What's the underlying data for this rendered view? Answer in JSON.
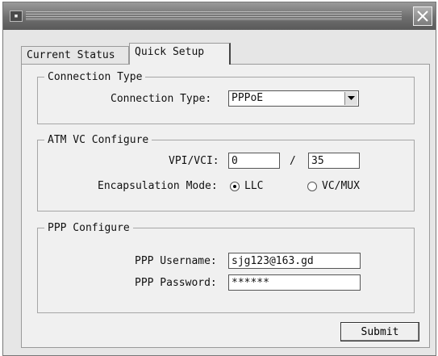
{
  "window": {
    "title": "",
    "close_icon": "close-x-icon"
  },
  "tabs": [
    {
      "label": "Current Status",
      "active": false
    },
    {
      "label": "Quick Setup",
      "active": true
    }
  ],
  "connection_type": {
    "legend": "Connection Type",
    "label": "Connection Type:",
    "value": "PPPoE"
  },
  "atm": {
    "legend": "ATM VC Configure",
    "vpi_vci_label": "VPI/VCI:",
    "vpi_value": "0",
    "separator": "/",
    "vci_value": "35",
    "encapsulation_label": "Encapsulation Mode:",
    "options": [
      {
        "label": "LLC",
        "checked": true
      },
      {
        "label": "VC/MUX",
        "checked": false
      }
    ]
  },
  "ppp": {
    "legend": "PPP Configure",
    "username_label": "PPP Username:",
    "username_value": "sjg123@163.gd",
    "password_label": "PPP Password:",
    "password_value": "******"
  },
  "submit_label": "Submit"
}
